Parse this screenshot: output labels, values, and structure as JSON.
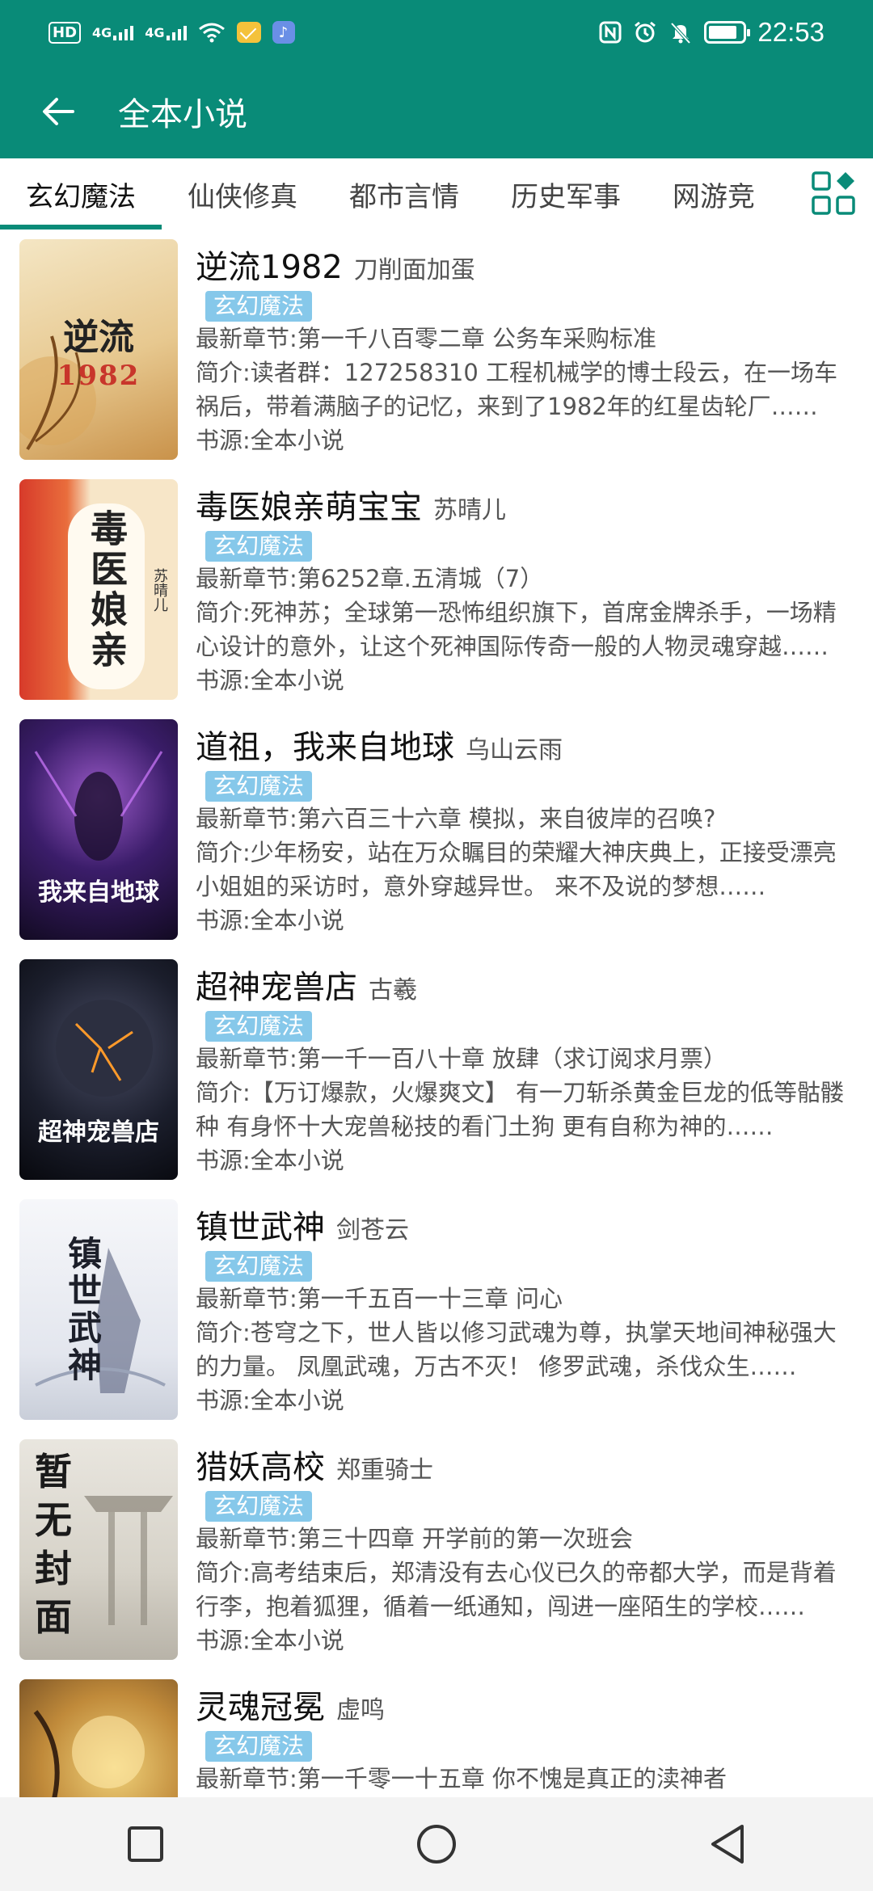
{
  "status_bar": {
    "hd": "HD",
    "sim1": "4G",
    "sim2": "4G",
    "time": "22:53"
  },
  "app_bar": {
    "title": "全本小说"
  },
  "tabs": [
    {
      "label": "玄幻魔法",
      "active": true
    },
    {
      "label": "仙侠修真"
    },
    {
      "label": "都市言情"
    },
    {
      "label": "历史军事"
    },
    {
      "label": "网游竞"
    }
  ],
  "books": [
    {
      "title": "逆流1982",
      "author": "刀削面加蛋",
      "tag": "玄幻魔法",
      "latest": "最新章节:第一千八百零二章 公务车采购标准",
      "intro": "简介:读者群：127258310 工程机械学的博士段云，在一场车祸后，带着满脑子的记忆，来到了1982年的红星齿轮厂……",
      "source": "书源:全本小说",
      "cover_text": "逆流1982"
    },
    {
      "title": "毒医娘亲萌宝宝",
      "author": "苏晴儿",
      "tag": "玄幻魔法",
      "latest": "最新章节:第6252章.五清城（7）",
      "intro": "简介:死神苏；全球第一恐怖组织旗下，首席金牌杀手，一场精心设计的意外，让这个死神国际传奇一般的人物灵魂穿越……",
      "source": "书源:全本小说",
      "cover_text": "毒医娘亲"
    },
    {
      "title": "道祖，我来自地球",
      "author": "乌山云雨",
      "tag": "玄幻魔法",
      "latest": "最新章节:第六百三十六章 模拟，来自彼岸的召唤?",
      "intro": "简介:少年杨安，站在万众瞩目的荣耀大神庆典上，正接受漂亮小姐姐的采访时，意外穿越异世。 来不及说的梦想……",
      "source": "书源:全本小说",
      "cover_text": "我来自地球"
    },
    {
      "title": "超神宠兽店",
      "author": "古羲",
      "tag": "玄幻魔法",
      "latest": "最新章节:第一千一百八十章 放肆（求订阅求月票）",
      "intro": "简介:【万订爆款，火爆爽文】 有一刀斩杀黄金巨龙的低等骷髅种 有身怀十大宠兽秘技的看门土狗 更有自称为神的……",
      "source": "书源:全本小说",
      "cover_text": "超神宠兽店"
    },
    {
      "title": "镇世武神",
      "author": "剑苍云",
      "tag": "玄幻魔法",
      "latest": "最新章节:第一千五百一十三章 问心",
      "intro": "简介:苍穹之下，世人皆以修习武魂为尊，执掌天地间神秘强大的力量。 凤凰武魂，万古不灭！ 修罗武魂，杀伐众生……",
      "source": "书源:全本小说",
      "cover_text": "镇世武神"
    },
    {
      "title": "猎妖高校",
      "author": "郑重骑士",
      "tag": "玄幻魔法",
      "latest": "最新章节:第三十四章 开学前的第一次班会",
      "intro": "简介:高考结束后，郑清没有去心仪已久的帝都大学，而是背着行李，抱着狐狸，循着一纸通知，闯进一座陌生的学校……",
      "source": "书源:全本小说",
      "cover_text": "暂无封面"
    },
    {
      "title": "灵魂冠冕",
      "author": "虚鸣",
      "tag": "玄幻魔法",
      "latest": "最新章节:第一千零一十五章 你不愧是真正的渎神者",
      "intro": "",
      "source": "",
      "cover_text": ""
    }
  ]
}
